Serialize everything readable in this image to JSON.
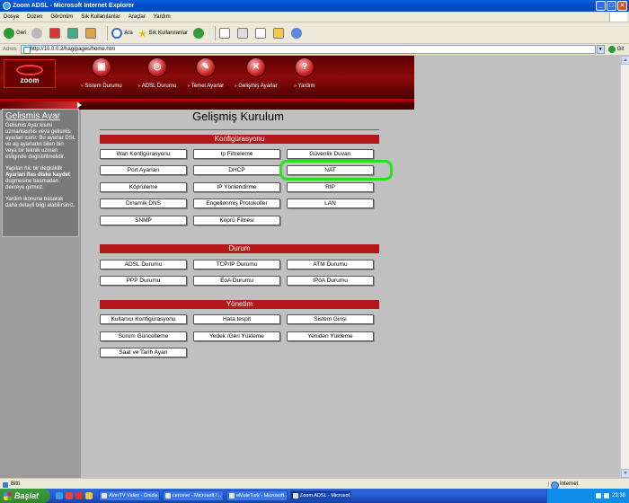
{
  "window": {
    "title": "Zoom ADSL - Microsoft Internet Explorer"
  },
  "menubar": [
    "Dosya",
    "Düzen",
    "Görünüm",
    "Sık Kullanılanlar",
    "Araçlar",
    "Yardım"
  ],
  "toolbar": {
    "back": "Geri",
    "search": "Ara",
    "favorites": "Sık Kullanılanlar"
  },
  "address": {
    "label": "Adres",
    "url": "http://10.0.0.2/hag/pages/home.htm",
    "go": "Git"
  },
  "nav": [
    "Sistem Durumu",
    "ADSL Durumu",
    "Temel Ayarlar",
    "Gelişmiş Ayarlar",
    "Yardım"
  ],
  "logo": "zoom",
  "help": {
    "title": "Gelismis Ayar",
    "p1": "Gelismis Ayar kismi uzmanlasmis veya gelismis ayarlari icerir. Bu ayarlar DSL ve ag ayarlarini bilen biri veya bir teknik uzman esliginde degistirilmelidir.",
    "p2_pre": "Yapilan hic bir degisiklik ",
    "p2_bold": "Ayarlari flas diske kaydet",
    "p2_post": " dugmesine basmadan devreye girmez.",
    "p3": "Yardim ikonuna basarak daha detayli bilgi alabilirsiniz."
  },
  "page_title": "Gelişmiş Kurulum",
  "sections": {
    "config": {
      "title": "Konfigürasyonu",
      "buttons": [
        "Wan Konfigürasyonu",
        "Ip Filtreleme",
        "Güvenlik Duvarı",
        "Port Ayarları",
        "DHCP",
        "NAT",
        "Köprüleme",
        "IP Yönlendirme",
        "RIP",
        "Dinamik DNS",
        "Engellenmiş Protokoller",
        "LAN",
        "SNMP",
        "Köprü Filtresi"
      ]
    },
    "status": {
      "title": "Durum",
      "buttons": [
        "ADSL Durumu",
        "TCP/IP Durumu",
        "ATM Durumu",
        "PPP Durumu",
        "EoA Durumu",
        "IPoA Durumu"
      ]
    },
    "admin": {
      "title": "Yönetim",
      "buttons": [
        "Kullanıcı Konfigürasyonu",
        "Hata tespit",
        "Sistem Girişi",
        "Sürüm Güncelleme",
        "Yedek /Geri Yükleme",
        "Yeniden Yükleme",
        "Saat ve Tarih Ayarı"
      ]
    }
  },
  "statusbar": {
    "left": "Bitti",
    "zone": "Internet"
  },
  "taskbar": {
    "start": "Başlat",
    "tasks": [
      "AVerTV Video - Önizle...",
      "cerceve - Microsoft I...",
      "eMuleTurk - Microsoft...",
      "Zoom ADSL - Microsof..."
    ],
    "clock": "23:38"
  },
  "colors": {
    "accent_red": "#b41818",
    "highlight_green": "#28e020",
    "xp_blue": "#245edb"
  }
}
